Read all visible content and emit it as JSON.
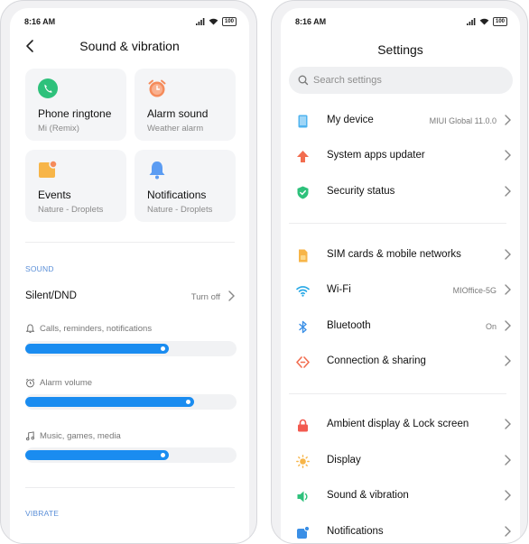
{
  "left": {
    "status": {
      "time": "8:16 AM",
      "battery": "100"
    },
    "title": "Sound & vibration",
    "tiles": [
      {
        "title": "Phone ringtone",
        "subtitle": "Mi (Remix)",
        "icon": "phone-icon",
        "color": "#2ec17b"
      },
      {
        "title": "Alarm sound",
        "subtitle": "Weather alarm",
        "icon": "alarm-clock-icon",
        "color": "#f58b5b"
      },
      {
        "title": "Events",
        "subtitle": "Nature - Droplets",
        "icon": "event-icon",
        "color": "#f7b548"
      },
      {
        "title": "Notifications",
        "subtitle": "Nature - Droplets",
        "icon": "bell-icon",
        "color": "#5b9cf2"
      }
    ],
    "sections": {
      "sound": "SOUND",
      "vibrate": "VIBRATE"
    },
    "silent_dnd": {
      "label": "Silent/DND",
      "value": "Turn off"
    },
    "volumes": [
      {
        "label": "Calls, reminders, notifications",
        "icon": "bell-outline-icon",
        "level": 0.68
      },
      {
        "label": "Alarm volume",
        "icon": "alarm-outline-icon",
        "level": 0.8
      },
      {
        "label": "Music, games, media",
        "icon": "music-note-icon",
        "level": 0.68
      }
    ],
    "accent": "#1a8cf0"
  },
  "right": {
    "status": {
      "time": "8:16 AM",
      "battery": "100"
    },
    "title": "Settings",
    "search": {
      "placeholder": "Search settings"
    },
    "items": [
      {
        "label": "My device",
        "value": "MIUI Global 11.0.0",
        "icon": "device-icon",
        "color": "#4fb3ef"
      },
      {
        "label": "System apps updater",
        "value": "",
        "icon": "arrow-up-icon",
        "color": "#f26d4f"
      },
      {
        "label": "Security status",
        "value": "",
        "icon": "shield-check-icon",
        "color": "#2ec17b"
      },
      {
        "label": "SIM cards & mobile networks",
        "value": "",
        "icon": "sim-card-icon",
        "color": "#f7b548"
      },
      {
        "label": "Wi-Fi",
        "value": "MIOffice-5G",
        "icon": "wifi-icon",
        "color": "#27a8e6"
      },
      {
        "label": "Bluetooth",
        "value": "On",
        "icon": "bluetooth-icon",
        "color": "#3a8fe6"
      },
      {
        "label": "Connection & sharing",
        "value": "",
        "icon": "share-icon",
        "color": "#f26d4f"
      },
      {
        "label": "Ambient display & Lock screen",
        "value": "",
        "icon": "lock-icon",
        "color": "#f25a4f"
      },
      {
        "label": "Display",
        "value": "",
        "icon": "sun-icon",
        "color": "#f7b548"
      },
      {
        "label": "Sound & vibration",
        "value": "",
        "icon": "speaker-icon",
        "color": "#2ec17b"
      },
      {
        "label": "Notifications",
        "value": "",
        "icon": "notifications-icon",
        "color": "#3a8fe6"
      }
    ]
  }
}
